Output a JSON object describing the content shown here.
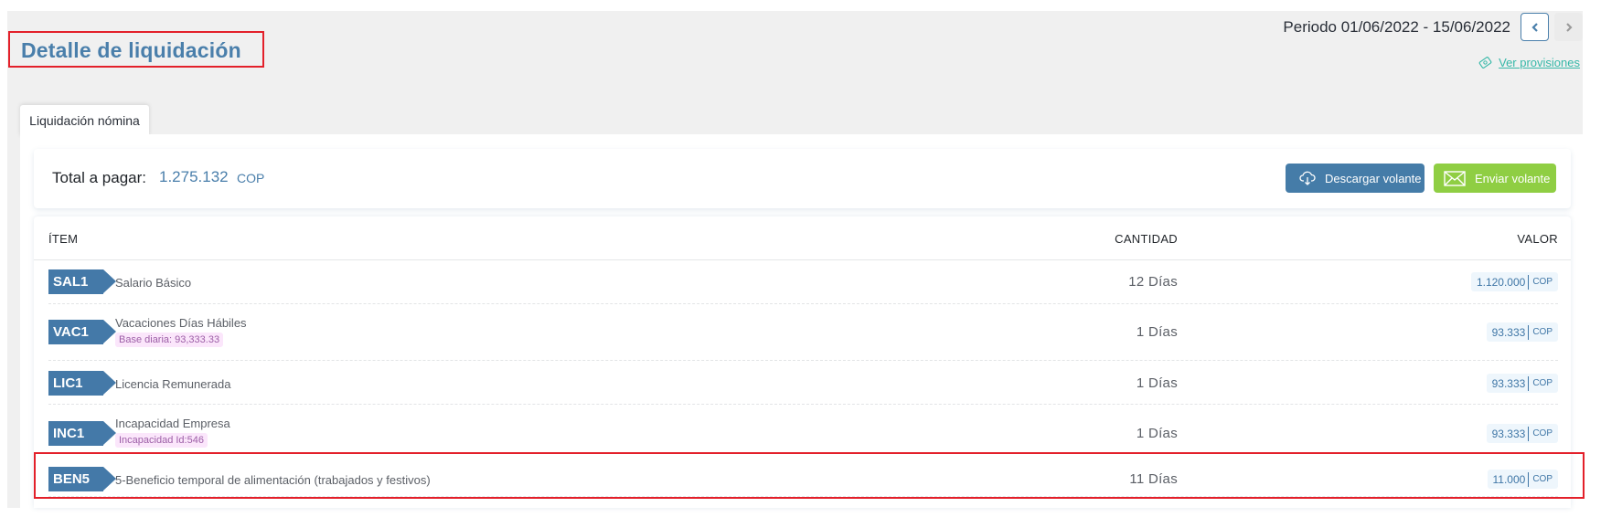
{
  "header": {
    "title": "Detalle de liquidación",
    "period": "Periodo 01/06/2022 - 15/06/2022",
    "prev_icon": "chevron-left-icon",
    "next_icon": "chevron-right-icon",
    "provisions_link": "Ver provisiones",
    "provisions_icon": "money-tag-icon"
  },
  "tabs": [
    {
      "label": "Liquidación nómina",
      "active": true
    }
  ],
  "summary": {
    "total_label": "Total a pagar:",
    "total_value": "1.275.132",
    "currency": "COP",
    "download_button": "Descargar volante",
    "download_icon": "cloud-download-icon",
    "send_button": "Enviar volante",
    "send_icon": "envelope-icon"
  },
  "colors": {
    "accent": "#4a7fab",
    "badge": "#4479a8",
    "send_green": "#8fce43",
    "highlight_red": "#e3202a",
    "provisions_link": "#36b8a8"
  },
  "table": {
    "columns": {
      "item": "ÍTEM",
      "quantity": "CANTIDAD",
      "value": "VALOR"
    },
    "rows": [
      {
        "code": "SAL1",
        "description": "Salario Básico",
        "detail": null,
        "quantity": "12 Días",
        "value": "1.120.000",
        "currency": "COP"
      },
      {
        "code": "VAC1",
        "description": "Vacaciones Días Hábiles",
        "detail": "Base diaria: 93,333.33",
        "quantity": "1 Días",
        "value": "93.333",
        "currency": "COP"
      },
      {
        "code": "LIC1",
        "description": "Licencia Remunerada",
        "detail": null,
        "quantity": "1 Días",
        "value": "93.333",
        "currency": "COP"
      },
      {
        "code": "INC1",
        "description": "Incapacidad Empresa",
        "detail": "Incapacidad Id:546",
        "quantity": "1 Días",
        "value": "93.333",
        "currency": "COP"
      },
      {
        "code": "BEN5",
        "description": "5-Beneficio temporal de alimentación (trabajados y festivos)",
        "detail": null,
        "quantity": "11 Días",
        "value": "11.000",
        "currency": "COP",
        "highlighted": true
      }
    ]
  }
}
